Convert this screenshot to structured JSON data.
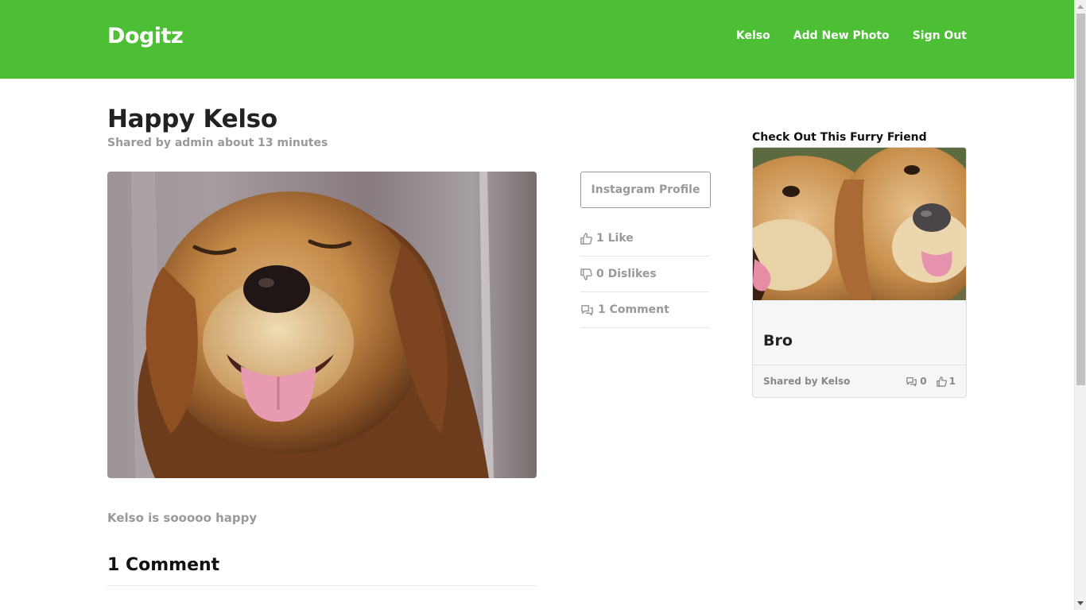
{
  "app": {
    "brand": "Dogitz",
    "nav": [
      {
        "label": "Kelso"
      },
      {
        "label": "Add New Photo"
      },
      {
        "label": "Sign Out"
      }
    ],
    "colors": {
      "accent": "#4cbf35",
      "muted": "#999999"
    }
  },
  "post": {
    "title": "Happy Kelso",
    "meta": "Shared by admin about 13 minutes",
    "description": "Kelso is sooooo happy",
    "comments_heading": "1 Comment",
    "photo_icon": "golden-retriever-photo"
  },
  "actions": {
    "instagram_label": "Instagram Profile",
    "likes": "1 Like",
    "dislikes": "0 Dislikes",
    "comments": "1 Comment"
  },
  "sidebar": {
    "heading": "Check Out This Furry Friend",
    "card": {
      "title": "Bro",
      "shared_by": "Shared by Kelso",
      "comment_count": "0",
      "like_count": "1"
    }
  }
}
